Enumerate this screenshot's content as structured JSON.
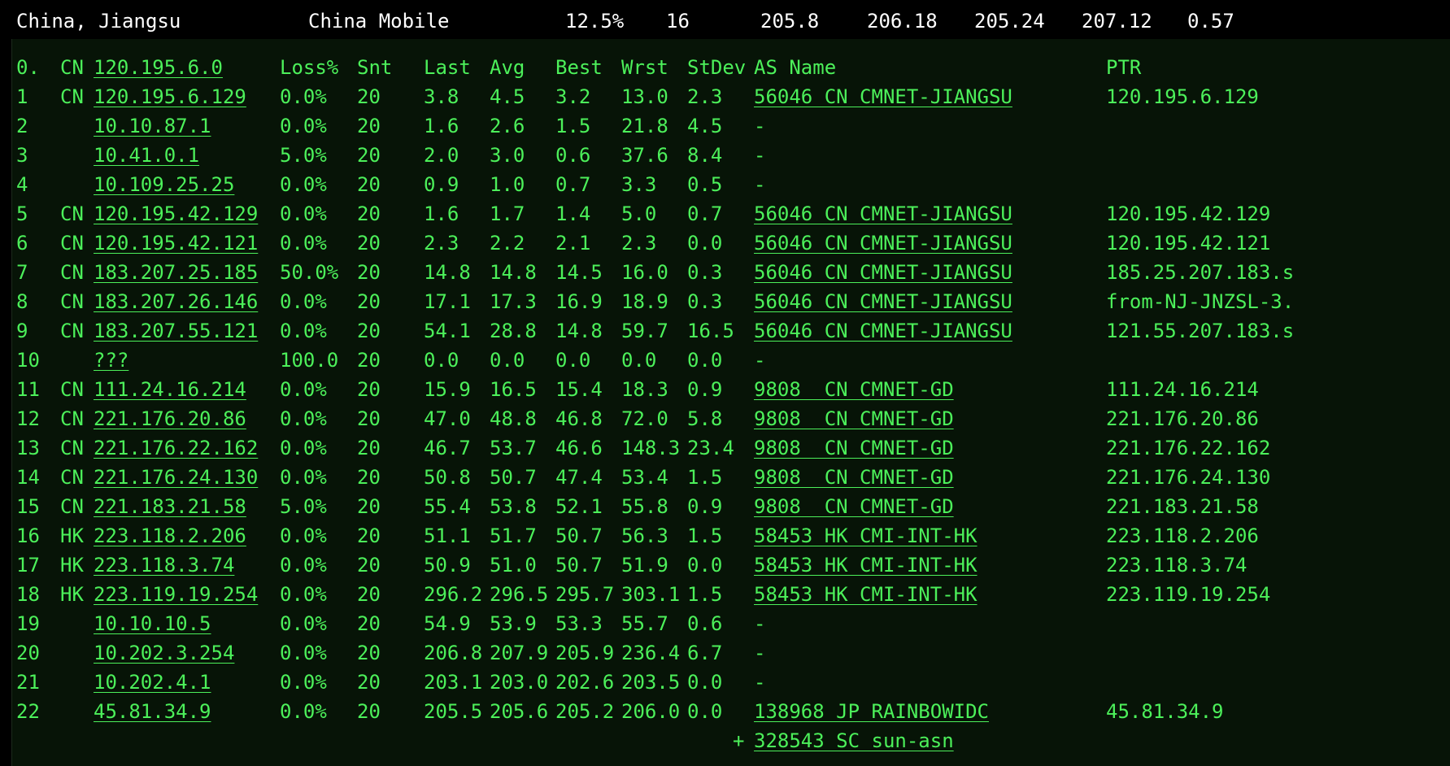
{
  "colors": {
    "text_green": "#4cf05a",
    "text_white": "#ffffff",
    "header_bg": "#000000",
    "panel_bg": "#071407"
  },
  "summary": {
    "location": "China, Jiangsu",
    "isp": "China Mobile",
    "loss": "12.5%",
    "snt": "16",
    "last": "205.8",
    "avg": "206.18",
    "best": "205.24",
    "wrst": "207.12",
    "stdev": "0.57"
  },
  "table": {
    "header": {
      "hop": "0.",
      "cc": "CN",
      "host": "120.195.6.0",
      "loss": "Loss%",
      "snt": "Snt",
      "last": "Last",
      "avg": "Avg",
      "best": "Best",
      "wrst": "Wrst",
      "stdev": "StDev",
      "asname": "AS Name",
      "ptr": "PTR"
    },
    "rows": [
      {
        "hop": "1",
        "cc": "CN",
        "host": "120.195.6.129",
        "loss": "0.0%",
        "snt": "20",
        "last": "3.8",
        "avg": "4.5",
        "best": "3.2",
        "wrst": "13.0",
        "stdev": "2.3",
        "asname": "56046 CN CMNET-JIANGSU",
        "ptr": "120.195.6.129"
      },
      {
        "hop": "2",
        "cc": "",
        "host": "10.10.87.1",
        "loss": "0.0%",
        "snt": "20",
        "last": "1.6",
        "avg": "2.6",
        "best": "1.5",
        "wrst": "21.8",
        "stdev": "4.5",
        "asname": "-",
        "ptr": ""
      },
      {
        "hop": "3",
        "cc": "",
        "host": "10.41.0.1",
        "loss": "5.0%",
        "snt": "20",
        "last": "2.0",
        "avg": "3.0",
        "best": "0.6",
        "wrst": "37.6",
        "stdev": "8.4",
        "asname": "-",
        "ptr": ""
      },
      {
        "hop": "4",
        "cc": "",
        "host": "10.109.25.25",
        "loss": "0.0%",
        "snt": "20",
        "last": "0.9",
        "avg": "1.0",
        "best": "0.7",
        "wrst": "3.3",
        "stdev": "0.5",
        "asname": "-",
        "ptr": ""
      },
      {
        "hop": "5",
        "cc": "CN",
        "host": "120.195.42.129",
        "loss": "0.0%",
        "snt": "20",
        "last": "1.6",
        "avg": "1.7",
        "best": "1.4",
        "wrst": "5.0",
        "stdev": "0.7",
        "asname": "56046 CN CMNET-JIANGSU",
        "ptr": "120.195.42.129"
      },
      {
        "hop": "6",
        "cc": "CN",
        "host": "120.195.42.121",
        "loss": "0.0%",
        "snt": "20",
        "last": "2.3",
        "avg": "2.2",
        "best": "2.1",
        "wrst": "2.3",
        "stdev": "0.0",
        "asname": "56046 CN CMNET-JIANGSU",
        "ptr": "120.195.42.121"
      },
      {
        "hop": "7",
        "cc": "CN",
        "host": "183.207.25.185",
        "loss": "50.0%",
        "snt": "20",
        "last": "14.8",
        "avg": "14.8",
        "best": "14.5",
        "wrst": "16.0",
        "stdev": "0.3",
        "asname": "56046 CN CMNET-JIANGSU",
        "ptr": "185.25.207.183.s"
      },
      {
        "hop": "8",
        "cc": "CN",
        "host": "183.207.26.146",
        "loss": "0.0%",
        "snt": "20",
        "last": "17.1",
        "avg": "17.3",
        "best": "16.9",
        "wrst": "18.9",
        "stdev": "0.3",
        "asname": "56046 CN CMNET-JIANGSU",
        "ptr": "from-NJ-JNZSL-3."
      },
      {
        "hop": "9",
        "cc": "CN",
        "host": "183.207.55.121",
        "loss": "0.0%",
        "snt": "20",
        "last": "54.1",
        "avg": "28.8",
        "best": "14.8",
        "wrst": "59.7",
        "stdev": "16.5",
        "asname": "56046 CN CMNET-JIANGSU",
        "ptr": "121.55.207.183.s"
      },
      {
        "hop": "10",
        "cc": "",
        "host": "???",
        "loss": "100.0",
        "snt": "20",
        "last": "0.0",
        "avg": "0.0",
        "best": "0.0",
        "wrst": "0.0",
        "stdev": "0.0",
        "asname": "-",
        "ptr": ""
      },
      {
        "hop": "11",
        "cc": "CN",
        "host": "111.24.16.214",
        "loss": "0.0%",
        "snt": "20",
        "last": "15.9",
        "avg": "16.5",
        "best": "15.4",
        "wrst": "18.3",
        "stdev": "0.9",
        "asname": "9808  CN CMNET-GD",
        "ptr": "111.24.16.214"
      },
      {
        "hop": "12",
        "cc": "CN",
        "host": "221.176.20.86",
        "loss": "0.0%",
        "snt": "20",
        "last": "47.0",
        "avg": "48.8",
        "best": "46.8",
        "wrst": "72.0",
        "stdev": "5.8",
        "asname": "9808  CN CMNET-GD",
        "ptr": "221.176.20.86"
      },
      {
        "hop": "13",
        "cc": "CN",
        "host": "221.176.22.162",
        "loss": "0.0%",
        "snt": "20",
        "last": "46.7",
        "avg": "53.7",
        "best": "46.6",
        "wrst": "148.3",
        "stdev": "23.4",
        "asname": "9808  CN CMNET-GD",
        "ptr": "221.176.22.162"
      },
      {
        "hop": "14",
        "cc": "CN",
        "host": "221.176.24.130",
        "loss": "0.0%",
        "snt": "20",
        "last": "50.8",
        "avg": "50.7",
        "best": "47.4",
        "wrst": "53.4",
        "stdev": "1.5",
        "asname": "9808  CN CMNET-GD",
        "ptr": "221.176.24.130"
      },
      {
        "hop": "15",
        "cc": "CN",
        "host": "221.183.21.58",
        "loss": "5.0%",
        "snt": "20",
        "last": "55.4",
        "avg": "53.8",
        "best": "52.1",
        "wrst": "55.8",
        "stdev": "0.9",
        "asname": "9808  CN CMNET-GD",
        "ptr": "221.183.21.58"
      },
      {
        "hop": "16",
        "cc": "HK",
        "host": "223.118.2.206",
        "loss": "0.0%",
        "snt": "20",
        "last": "51.1",
        "avg": "51.7",
        "best": "50.7",
        "wrst": "56.3",
        "stdev": "1.5",
        "asname": "58453 HK CMI-INT-HK",
        "ptr": "223.118.2.206"
      },
      {
        "hop": "17",
        "cc": "HK",
        "host": "223.118.3.74",
        "loss": "0.0%",
        "snt": "20",
        "last": "50.9",
        "avg": "51.0",
        "best": "50.7",
        "wrst": "51.9",
        "stdev": "0.0",
        "asname": "58453 HK CMI-INT-HK",
        "ptr": "223.118.3.74"
      },
      {
        "hop": "18",
        "cc": "HK",
        "host": "223.119.19.254",
        "loss": "0.0%",
        "snt": "20",
        "last": "296.2",
        "avg": "296.5",
        "best": "295.7",
        "wrst": "303.1",
        "stdev": "1.5",
        "asname": "58453 HK CMI-INT-HK",
        "ptr": "223.119.19.254"
      },
      {
        "hop": "19",
        "cc": "",
        "host": "10.10.10.5",
        "loss": "0.0%",
        "snt": "20",
        "last": "54.9",
        "avg": "53.9",
        "best": "53.3",
        "wrst": "55.7",
        "stdev": "0.6",
        "asname": "-",
        "ptr": ""
      },
      {
        "hop": "20",
        "cc": "",
        "host": "10.202.3.254",
        "loss": "0.0%",
        "snt": "20",
        "last": "206.8",
        "avg": "207.9",
        "best": "205.9",
        "wrst": "236.4",
        "stdev": "6.7",
        "asname": "-",
        "ptr": ""
      },
      {
        "hop": "21",
        "cc": "",
        "host": "10.202.4.1",
        "loss": "0.0%",
        "snt": "20",
        "last": "203.1",
        "avg": "203.0",
        "best": "202.6",
        "wrst": "203.5",
        "stdev": "0.0",
        "asname": "-",
        "ptr": ""
      },
      {
        "hop": "22",
        "cc": "",
        "host": "45.81.34.9",
        "loss": "0.0%",
        "snt": "20",
        "last": "205.5",
        "avg": "205.6",
        "best": "205.2",
        "wrst": "206.0",
        "stdev": "0.0",
        "asname": "138968 JP RAINBOWIDC",
        "ptr": "45.81.34.9"
      }
    ],
    "extra": {
      "marker": "+",
      "asname": "328543 SC sun-asn"
    }
  }
}
